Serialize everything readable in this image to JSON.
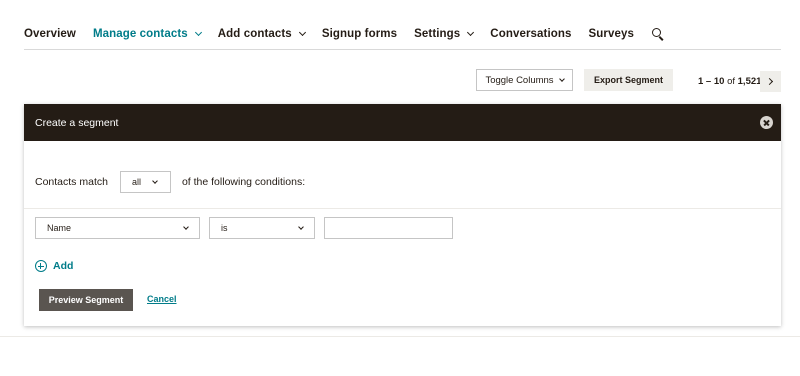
{
  "nav": {
    "items": [
      {
        "label": "Overview",
        "active": false,
        "dropdown": false
      },
      {
        "label": "Manage contacts",
        "active": true,
        "dropdown": true
      },
      {
        "label": "Add contacts",
        "active": false,
        "dropdown": true
      },
      {
        "label": "Signup forms",
        "active": false,
        "dropdown": false
      },
      {
        "label": "Settings",
        "active": false,
        "dropdown": true
      },
      {
        "label": "Conversations",
        "active": false,
        "dropdown": false
      },
      {
        "label": "Surveys",
        "active": false,
        "dropdown": false
      }
    ],
    "search_icon": "search-icon"
  },
  "toolbar": {
    "toggle_columns_label": "Toggle Columns",
    "export_segment_label": "Export Segment",
    "pager": {
      "range": "1 – 10",
      "of_word": "of",
      "total": "1,521"
    }
  },
  "segment": {
    "header_title": "Create a segment",
    "match_prefix": "Contacts match",
    "match_value": "all",
    "match_suffix": "of the following conditions:",
    "condition": {
      "field": "Name",
      "operator": "is",
      "value": ""
    },
    "add_label": "Add",
    "preview_label": "Preview Segment",
    "cancel_label": "Cancel"
  },
  "colors": {
    "accent": "#007c89",
    "header_bg": "#241c15",
    "text": "#241c15",
    "secondary_button": "#efeeea",
    "preview_button": "#5a5550"
  }
}
